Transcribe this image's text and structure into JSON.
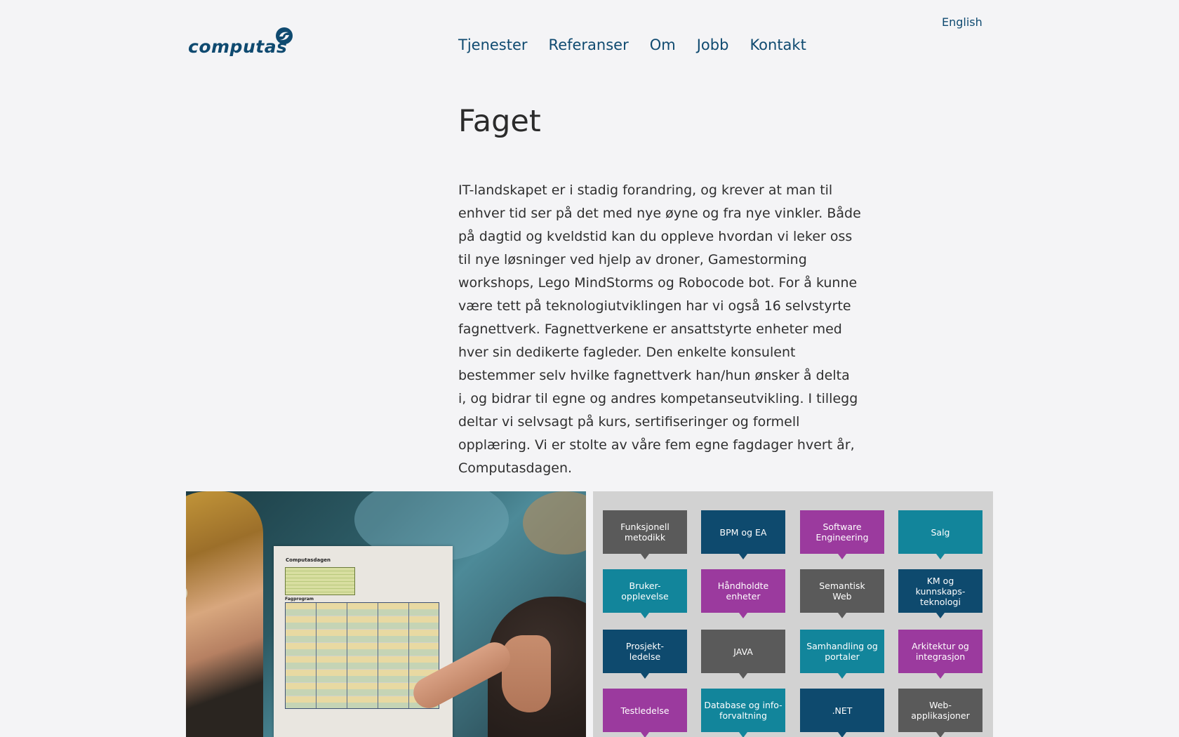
{
  "header": {
    "logo_text": "computas",
    "language_link": "English",
    "nav": [
      "Tjenester",
      "Referanser",
      "Om",
      "Jobb",
      "Kontakt"
    ]
  },
  "main": {
    "title": "Faget",
    "intro": "IT-landskapet er i stadig forandring, og krever at man til enhver tid ser på det med nye øyne og fra nye vinkler. Både på dagtid og kveldstid kan du oppleve hvordan vi leker oss til nye løsninger ved hjelp av droner, Gamestorming workshops, Lego MindStorms og Robocode bot. For å kunne være tett på teknologiutviklingen har vi også 16 selvstyrte fagnettverk. Fagnettverkene er ansattstyrte enheter med hver sin dedikerte fagleder. Den enkelte konsulent bestemmer selv hvilke fagnettverk han/hun ønsker å delta i, og bidrar til egne og andres kompetanseutvikling. I tillegg deltar vi selvsagt på kurs, sertifiseringer og formell opplæring. Vi er stolte av våre fem egne fagdager hvert år, Computasdagen."
  },
  "photo": {
    "poster_title": "Computasdagen",
    "poster_subtitle": "Fagprogram"
  },
  "colors": {
    "gray": "#5a5a5a",
    "navy": "#0e4a6e",
    "purple": "#9b3a9e",
    "teal": "#12859b",
    "brand": "#0f4a70"
  },
  "tiles": [
    {
      "label": "Funksjonell\nmetodikk",
      "color": "gray"
    },
    {
      "label": "BPM og EA",
      "color": "navy"
    },
    {
      "label": "Software\nEngineering",
      "color": "purple"
    },
    {
      "label": "Salg",
      "color": "teal"
    },
    {
      "label": "Bruker-\nopplevelse",
      "color": "teal"
    },
    {
      "label": "Håndholdte\nenheter",
      "color": "purple"
    },
    {
      "label": "Semantisk\nWeb",
      "color": "gray"
    },
    {
      "label": "KM og kunnskaps-\nteknologi",
      "color": "navy"
    },
    {
      "label": "Prosjekt-\nledelse",
      "color": "navy"
    },
    {
      "label": "JAVA",
      "color": "gray"
    },
    {
      "label": "Samhandling og\nportaler",
      "color": "teal"
    },
    {
      "label": "Arkitektur og\nintegrasjon",
      "color": "purple"
    },
    {
      "label": "Testledelse",
      "color": "purple"
    },
    {
      "label": "Database og info-\nforvaltning",
      "color": "teal"
    },
    {
      "label": ".NET",
      "color": "navy"
    },
    {
      "label": "Web-\napplikasjoner",
      "color": "gray"
    }
  ]
}
